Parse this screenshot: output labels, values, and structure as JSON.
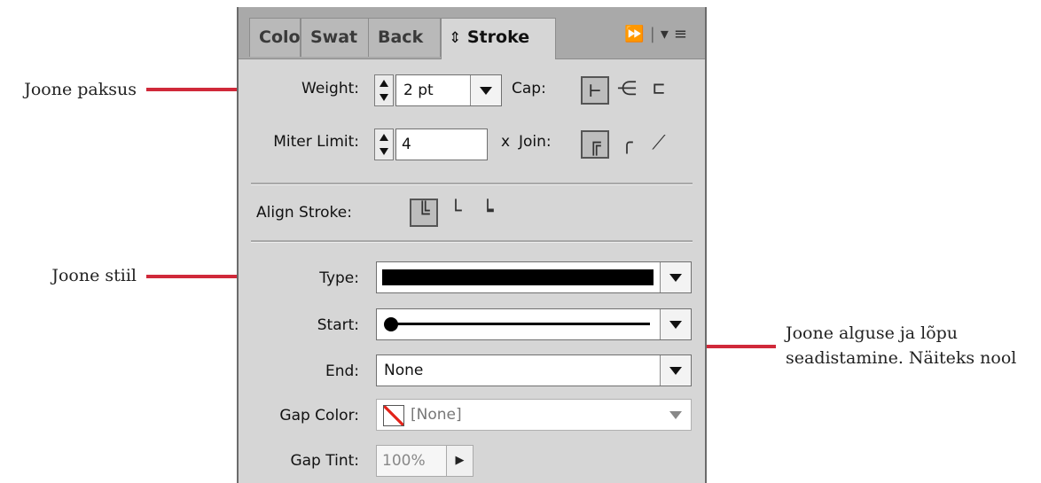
{
  "annotations": {
    "weight_note": "Joone paksus",
    "style_note": "Joone stiil",
    "arrow_note_line1": "Joone alguse ja lõpu",
    "arrow_note_line2": "seadistamine. Näiteks nool",
    "accent_color": "#d0293a"
  },
  "panel": {
    "tabs": [
      "Colo",
      "Swat",
      "Back",
      "Stroke"
    ],
    "active_tab": "Stroke",
    "tab_icon_active": "up-down-arrows-icon",
    "toolbar_icons": [
      "collapse-panels-icon",
      "panel-menu-icon"
    ],
    "weight": {
      "label": "Weight:",
      "value": "2 pt"
    },
    "cap": {
      "label": "Cap:",
      "options": [
        "butt-cap-icon",
        "round-cap-icon",
        "projecting-cap-icon"
      ],
      "selected": 0
    },
    "miter": {
      "label": "Miter Limit:",
      "value": "4",
      "unit": "x"
    },
    "join": {
      "label": "Join:",
      "options": [
        "miter-join-icon",
        "round-join-icon",
        "bevel-join-icon"
      ],
      "selected": 0
    },
    "align": {
      "label": "Align Stroke:",
      "options": [
        "align-center-icon",
        "align-inside-icon",
        "align-outside-icon"
      ],
      "selected": 0
    },
    "type": {
      "label": "Type:"
    },
    "start": {
      "label": "Start:"
    },
    "end": {
      "label": "End:",
      "value": "None"
    },
    "gap_color": {
      "label": "Gap Color:",
      "value": "[None]"
    },
    "gap_tint": {
      "label": "Gap Tint:",
      "value": "100%"
    }
  }
}
